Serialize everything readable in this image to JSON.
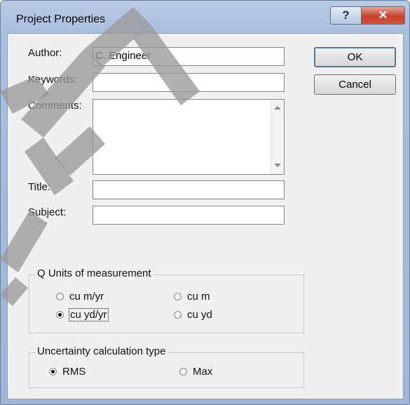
{
  "window": {
    "title": "Project Properties",
    "help_symbol": "?",
    "close_symbol": "✕"
  },
  "form": {
    "author_label": "Author:",
    "author_value": "C. Engineer",
    "keywords_label": "Keywords:",
    "keywords_value": "",
    "comments_label": "Comments:",
    "comments_value": "",
    "title_label": "Title:",
    "title_value": "",
    "subject_label": "Subject:",
    "subject_value": ""
  },
  "buttons": {
    "ok": "OK",
    "cancel": "Cancel"
  },
  "units_group": {
    "legend": "Q Units of measurement",
    "options": [
      "cu m/yr",
      "cu m",
      "cu yd/yr",
      "cu yd"
    ],
    "selected": "cu yd/yr"
  },
  "uncertainty_group": {
    "legend": "Uncertainty calculation type",
    "options": [
      "RMS",
      "Max"
    ],
    "selected": "RMS"
  },
  "watermark": {
    "color": "#9a9a9a"
  }
}
